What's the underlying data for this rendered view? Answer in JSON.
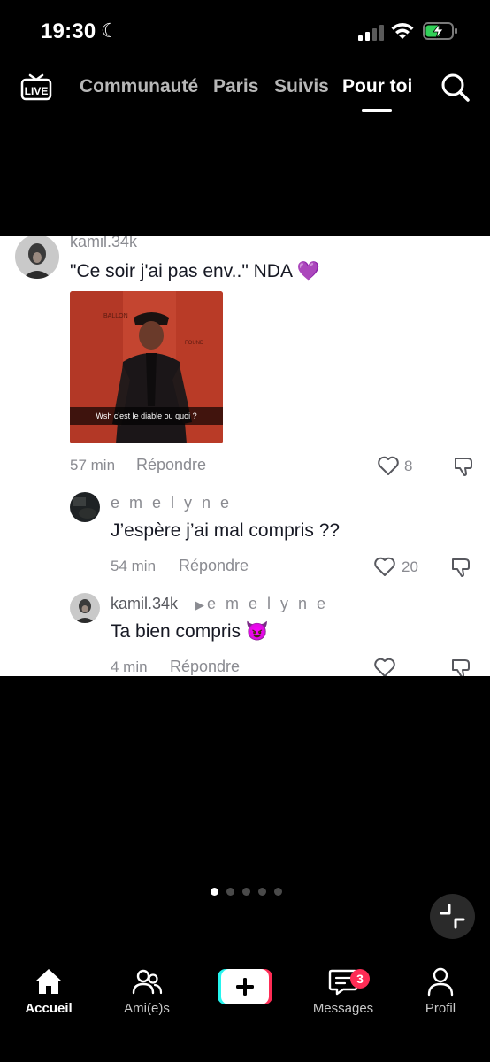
{
  "status_bar": {
    "time": "19:30",
    "battery_charging": true
  },
  "top_nav": {
    "live_label": "LIVE",
    "tabs": [
      {
        "label": "Communauté",
        "active": false
      },
      {
        "label": "Paris",
        "active": false
      },
      {
        "label": "Suivis",
        "active": false
      },
      {
        "label": "Pour toi",
        "active": true
      }
    ],
    "search_icon": "search-icon"
  },
  "comments": [
    {
      "username": "kamil.34k",
      "text": "\"Ce soir j'ai pas env..\" NDA 💜",
      "image_caption": "Wsh c'est le diable ou quoi ?",
      "time": "57 min",
      "reply_label": "Répondre",
      "likes": "8"
    },
    {
      "username": "e m e l y n e",
      "text": "J’espère j’ai mal compris ??",
      "time": "54 min",
      "reply_label": "Répondre",
      "likes": "20"
    },
    {
      "username": "kamil.34k",
      "reply_to": "e m e l y n e",
      "text": "Ta bien compris 😈",
      "time": "4 min",
      "reply_label": "Répondre",
      "likes": ""
    }
  ],
  "pager": {
    "count": 5,
    "active_index": 0
  },
  "bottom_nav": {
    "items": [
      {
        "label": "Accueil",
        "icon": "home-icon",
        "active": true
      },
      {
        "label": "Ami(e)s",
        "icon": "friends-icon",
        "active": false
      },
      {
        "label": "",
        "icon": "create-plus-icon",
        "active": false
      },
      {
        "label": "Messages",
        "icon": "messages-icon",
        "active": false,
        "badge": "3"
      },
      {
        "label": "Profil",
        "icon": "profile-icon",
        "active": false
      }
    ]
  },
  "colors": {
    "accent_red": "#fe2c55",
    "accent_cyan": "#25f4ee",
    "emoji_heart": "#9b4de0"
  }
}
